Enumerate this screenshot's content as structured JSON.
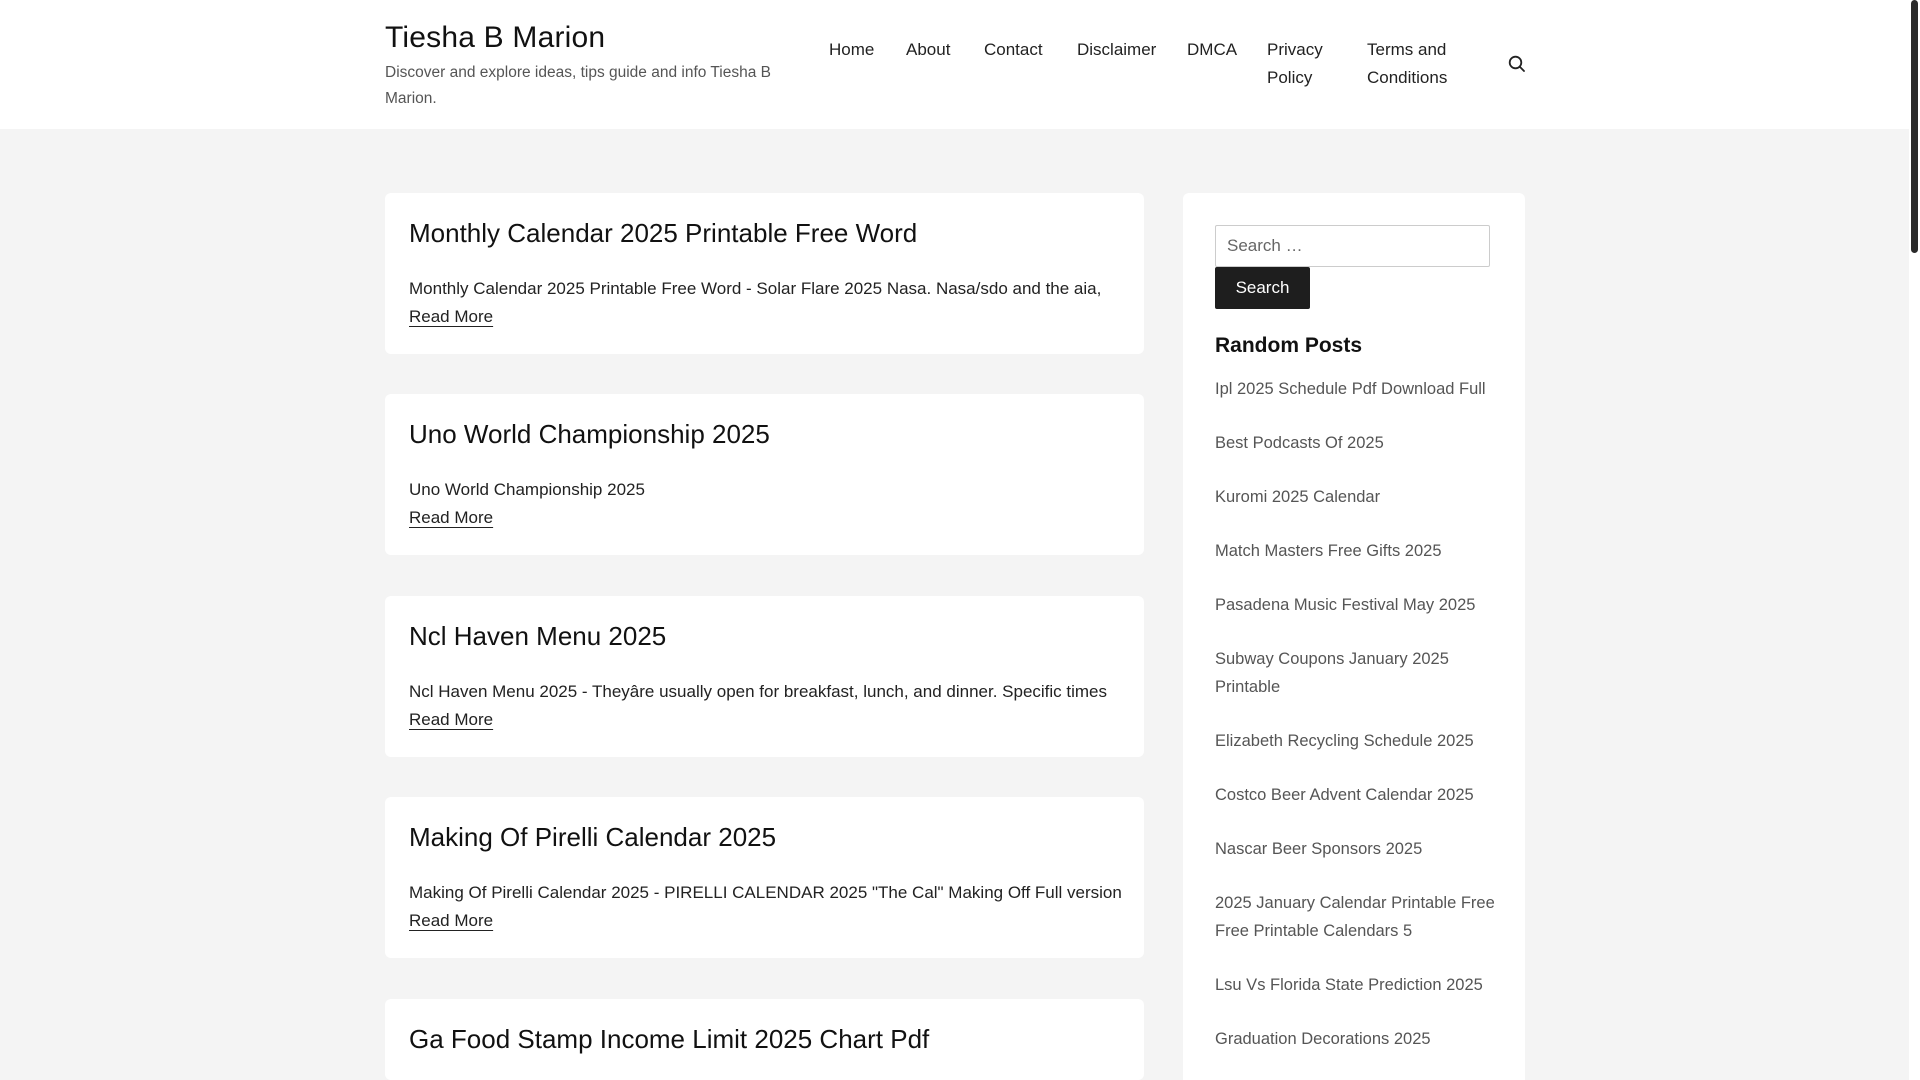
{
  "header": {
    "site_title": "Tiesha B Marion",
    "site_description": "Discover and explore ideas, tips guide and info Tiesha B Marion.",
    "nav": [
      {
        "label": "Home"
      },
      {
        "label": "About"
      },
      {
        "label": "Contact"
      },
      {
        "label": "Disclaimer"
      },
      {
        "label": "DMCA"
      },
      {
        "label": "Privacy Policy"
      },
      {
        "label": "Terms and Conditions"
      }
    ],
    "search_icon": "search-icon"
  },
  "posts": [
    {
      "title": "Monthly Calendar 2025 Printable Free Word",
      "excerpt": "Monthly Calendar 2025 Printable Free Word - Solar Flare 2025 Nasa. Nasa/sdo and the aia,",
      "read_more": "Read More"
    },
    {
      "title": "Uno World Championship 2025",
      "excerpt": "Uno World Championship 2025",
      "read_more": "Read More"
    },
    {
      "title": "Ncl Haven Menu 2025",
      "excerpt": "Ncl Haven Menu 2025 - Theyâre usually open for breakfast, lunch, and dinner. Specific times",
      "read_more": "Read More"
    },
    {
      "title": "Making Of Pirelli Calendar 2025",
      "excerpt": "Making Of Pirelli Calendar 2025 - PIRELLI CALENDAR 2025 \"The Cal\" Making Off Full version",
      "read_more": "Read More"
    },
    {
      "title": "Ga Food Stamp Income Limit 2025 Chart Pdf"
    }
  ],
  "sidebar": {
    "search_placeholder": "Search …",
    "search_button": "Search",
    "random_posts_title": "Random Posts",
    "random_posts": [
      "Ipl 2025 Schedule Pdf Download Full",
      "Best Podcasts Of 2025",
      "Kuromi 2025 Calendar",
      "Match Masters Free Gifts 2025",
      "Pasadena Music Festival May 2025",
      "Subway Coupons January 2025 Printable",
      "Elizabeth Recycling Schedule 2025",
      "Costco Beer Advent Calendar 2025",
      "Nascar Beer Sponsors 2025",
      "2025 January Calendar Printable Free Free Printable Calendars 5",
      "Lsu Vs Florida State Prediction 2025",
      "Graduation Decorations 2025"
    ]
  },
  "colors": {
    "page_background": "#f4f4f4",
    "card_background": "#ffffff",
    "button_background": "#1e1e1e"
  }
}
